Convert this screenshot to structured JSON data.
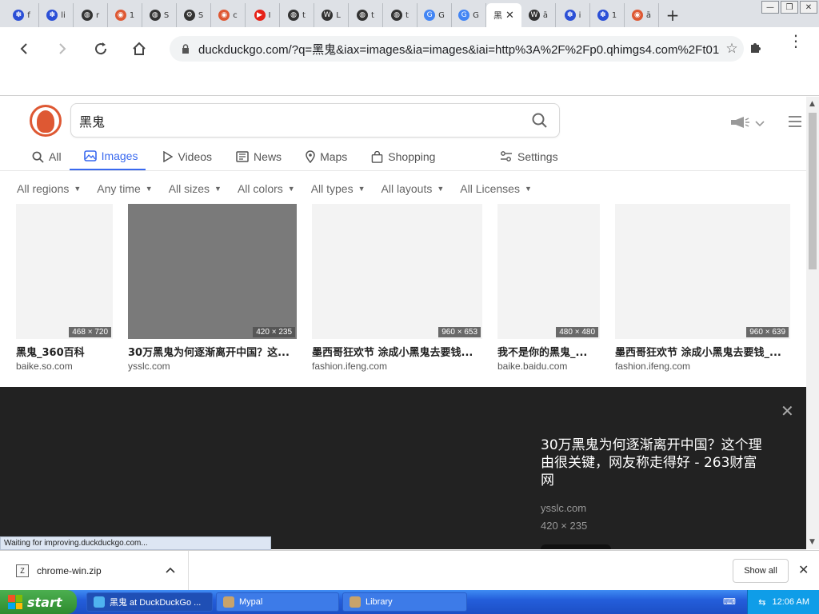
{
  "window": {
    "tabs": [
      {
        "label": "f",
        "icon": "paw-icon",
        "color": "#2b4fd6"
      },
      {
        "label": "li",
        "icon": "paw-icon",
        "color": "#2b4fd6"
      },
      {
        "label": "r",
        "icon": "globe-icon",
        "color": "#333333"
      },
      {
        "label": "1",
        "icon": "duckduckgo-icon",
        "color": "#de5833"
      },
      {
        "label": "S",
        "icon": "globe-icon",
        "color": "#333333"
      },
      {
        "label": "S",
        "icon": "gear-icon",
        "color": "#333333"
      },
      {
        "label": "c",
        "icon": "duckduckgo-icon",
        "color": "#de5833"
      },
      {
        "label": "I",
        "icon": "youtube-icon",
        "color": "#e62117"
      },
      {
        "label": "t",
        "icon": "globe-icon",
        "color": "#333333"
      },
      {
        "label": "L",
        "icon": "wikipedia-icon",
        "color": "#333333"
      },
      {
        "label": "t",
        "icon": "globe-icon",
        "color": "#333333"
      },
      {
        "label": "t",
        "icon": "globe-icon",
        "color": "#333333"
      },
      {
        "label": "G",
        "icon": "translate-icon",
        "color": "#4285f4"
      },
      {
        "label": "G",
        "icon": "translate-icon",
        "color": "#4285f4"
      }
    ],
    "active_tab": {
      "label": "黑"
    },
    "tabs_after": [
      {
        "label": "ā",
        "icon": "wikipedia-icon",
        "color": "#333333"
      },
      {
        "label": "i",
        "icon": "paw-icon",
        "color": "#2b4fd6"
      },
      {
        "label": "1",
        "icon": "paw-icon",
        "color": "#2b4fd6"
      },
      {
        "label": "ā",
        "icon": "duckduckgo-icon",
        "color": "#de5833"
      }
    ],
    "newtab": "+"
  },
  "toolbar": {
    "url": "duckduckgo.com/?q=黑鬼&iax=images&ia=images&iai=http%3A%2F%2Fp0.qhimgs4.com%2Ft016c190"
  },
  "search": {
    "query": "黑鬼",
    "nav": [
      {
        "label": "All",
        "icon": "search-icon"
      },
      {
        "label": "Images",
        "icon": "image-icon",
        "active": true
      },
      {
        "label": "Videos",
        "icon": "play-icon"
      },
      {
        "label": "News",
        "icon": "news-icon"
      },
      {
        "label": "Maps",
        "icon": "map-pin-icon"
      },
      {
        "label": "Shopping",
        "icon": "shopping-bag-icon"
      }
    ],
    "settings": "Settings",
    "filters": [
      "All regions",
      "Any time",
      "All sizes",
      "All colors",
      "All types",
      "All layouts",
      "All Licenses"
    ]
  },
  "results": [
    {
      "title": "黑鬼_360百科",
      "source": "baike.so.com",
      "dims": "468 × 720"
    },
    {
      "title": "30万黑鬼为何逐渐离开中国？这...",
      "source": "ysslc.com",
      "dims": "420 × 235"
    },
    {
      "title": "墨西哥狂欢节 涂成小黑鬼去要钱...",
      "source": "fashion.ifeng.com",
      "dims": "960 × 653"
    },
    {
      "title": "我不是你的黑鬼_...",
      "source": "baike.baidu.com",
      "dims": "480 × 480"
    },
    {
      "title": "墨西哥狂欢节 涂成小黑鬼去要钱_...",
      "source": "fashion.ifeng.com",
      "dims": "960 × 639"
    }
  ],
  "detail": {
    "title": "30万黑鬼为何逐渐离开中国？这个理由很关键，网友称走得好 - 263财富网",
    "source": "ysslc.com",
    "dims": "420 × 235"
  },
  "status": "Waiting for improving.duckduckgo.com...",
  "downloads": {
    "file": "chrome-win.zip",
    "show_all": "Show all"
  },
  "taskbar": {
    "start": "start",
    "items": [
      {
        "label": "黑鬼 at DuckDuckGo ..."
      },
      {
        "label": "Mypal"
      },
      {
        "label": "Library"
      }
    ],
    "clock": "12:06 AM"
  }
}
